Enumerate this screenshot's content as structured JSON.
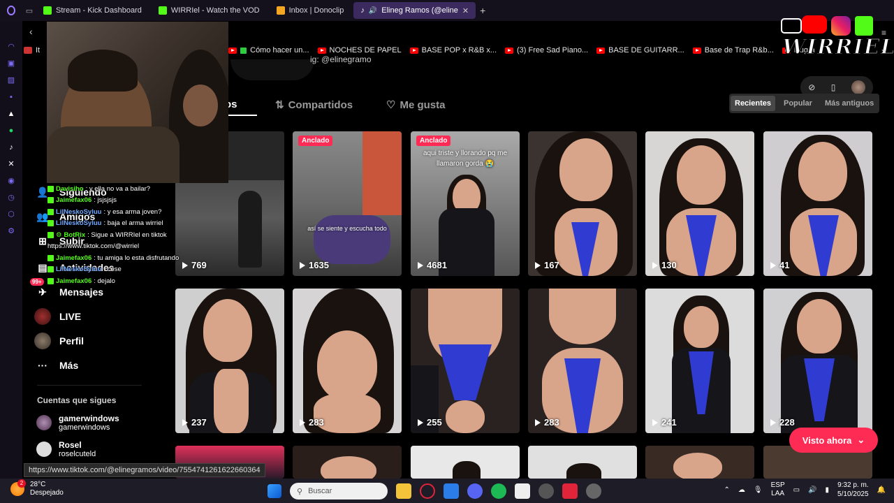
{
  "browser": {
    "tabs": [
      {
        "label": "Stream - Kick Dashboard",
        "color": "#53fc18"
      },
      {
        "label": "WIRRIel - Watch the VOD",
        "color": "#53fc18"
      },
      {
        "label": "Inbox | Donoclip",
        "color": "#f5a623"
      },
      {
        "label": "Elineg Ramos (@eline",
        "color": "#ffffff",
        "active": true
      }
    ],
    "bookmarks": [
      {
        "label": "Cómo hacer un...",
        "icon": "checkbox-icon"
      },
      {
        "label": "NOCHES DE PAPEL"
      },
      {
        "label": "BASE POP x R&B x..."
      },
      {
        "label": "(3) Free Sad Piano..."
      },
      {
        "label": "BASE DE GUITARR..."
      },
      {
        "label": "Base de Trap R&b..."
      },
      {
        "label": "Rugra"
      }
    ],
    "bookmark_prefix": "It"
  },
  "profile": {
    "handle_partial": "ig: @elinegramo",
    "tabs": [
      {
        "label": "os",
        "active": true
      },
      {
        "label": "Compartidos"
      },
      {
        "label": "Me gusta"
      }
    ],
    "sort": [
      "Recientes",
      "Popular",
      "Más antiguos"
    ]
  },
  "nav": {
    "items": [
      {
        "label": "Siguiendo"
      },
      {
        "label": "Amigos"
      },
      {
        "label": "Subir"
      },
      {
        "label": "Actividades"
      },
      {
        "label": "Mensajes",
        "badge": "99+"
      },
      {
        "label": "LIVE"
      },
      {
        "label": "Perfil"
      },
      {
        "label": "Más"
      }
    ],
    "following_title": "Cuentas que sigues",
    "following": [
      {
        "name": "gamerwindows",
        "handle": "gamerwindows"
      },
      {
        "name": "Rosel",
        "handle": "roselcuteld"
      }
    ]
  },
  "chat": [
    {
      "user": "Davisiho",
      "msg": ": y ella no va a bailar?"
    },
    {
      "user": "Jaimefax06",
      "msg": ": jsjsjsjs"
    },
    {
      "user": "LilNeskoSyluu",
      "msg": ": y esa arma joven?"
    },
    {
      "user": "LilNeskoSyluu",
      "msg": ": baja el arma wirriel"
    },
    {
      "user": "BotRix",
      "msg": ": Sigue a WIRRIel en tiktok"
    },
    {
      "user": "",
      "msg": "https://www.tiktok.com/@wirriel"
    },
    {
      "user": "Jaimefax06",
      "msg": ": tu amiga lo esta disfrutando"
    },
    {
      "user": "LilNeskoSyluu",
      "msg": ": cese"
    },
    {
      "user": "Jaimefax06",
      "msg": ": dejalo"
    }
  ],
  "videos": [
    {
      "count": "769",
      "pinned": false
    },
    {
      "count": "1635",
      "pinned": true,
      "pin_label": "Anclado",
      "subcaption": "así se siente y escucha todo"
    },
    {
      "count": "4681",
      "pinned": true,
      "pin_label": "Anclado",
      "caption": "aqui triste y llorando pq me llamaron gorda 😭"
    },
    {
      "count": "167"
    },
    {
      "count": "130"
    },
    {
      "count": "41"
    },
    {
      "count": "237"
    },
    {
      "count": "283"
    },
    {
      "count": "255"
    },
    {
      "count": "283"
    },
    {
      "count": "241"
    },
    {
      "count": "228"
    }
  ],
  "visto_label": "Visto ahora",
  "status_url": "https://www.tiktok.com/@elinegramos/video/7554741261622660364",
  "taskbar": {
    "weather_temp": "28°C",
    "weather_desc": "Despejado",
    "weather_badge": "2",
    "search_placeholder": "Buscar",
    "lang1": "ESP",
    "lang2": "LAA",
    "time": "9:32 p. m.",
    "date": "5/10/2025"
  },
  "watermark": "WIRRIEL"
}
